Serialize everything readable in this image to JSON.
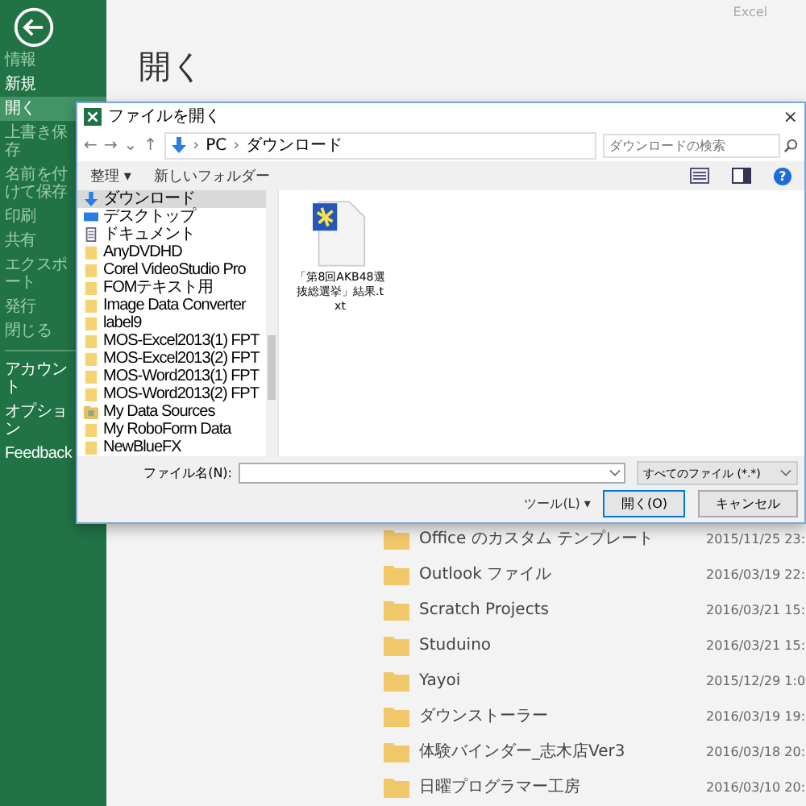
{
  "app_label": "Excel",
  "sidebar": {
    "items": [
      {
        "label": "情報",
        "selected": false,
        "disabled": true
      },
      {
        "label": "新規",
        "selected": false,
        "disabled": false
      },
      {
        "label": "開く",
        "selected": true,
        "disabled": false
      },
      {
        "label": "上書き保存",
        "selected": false,
        "disabled": true
      },
      {
        "label": "名前を付けて保存",
        "selected": false,
        "disabled": true
      },
      {
        "label": "印刷",
        "selected": false,
        "disabled": true
      },
      {
        "label": "共有",
        "selected": false,
        "disabled": true
      },
      {
        "label": "エクスポート",
        "selected": false,
        "disabled": true
      },
      {
        "label": "発行",
        "selected": false,
        "disabled": true
      },
      {
        "label": "閉じる",
        "selected": false,
        "disabled": true
      }
    ],
    "footer_items": [
      {
        "label": "アカウント",
        "selected": false,
        "disabled": false
      },
      {
        "label": "オプション",
        "selected": false,
        "disabled": false
      },
      {
        "label": "Feedback",
        "selected": false,
        "disabled": false
      }
    ]
  },
  "page_title": "開く",
  "recent_folders": [
    {
      "name": "Office のカスタム テンプレート",
      "date": "2015/11/25 23:"
    },
    {
      "name": "Outlook ファイル",
      "date": "2016/03/19 22:"
    },
    {
      "name": "Scratch Projects",
      "date": "2016/03/21 15:"
    },
    {
      "name": "Studuino",
      "date": "2016/03/21 15:"
    },
    {
      "name": "Yayoi",
      "date": "2015/12/29 1:0"
    },
    {
      "name": "ダウンストーラー",
      "date": "2016/03/19 19:"
    },
    {
      "name": "体験バインダー_志木店Ver3",
      "date": "2016/03/18 20:"
    },
    {
      "name": "日曜プログラマー工房",
      "date": "2016/03/10 20:"
    }
  ],
  "dialog": {
    "title": "ファイルを開く",
    "close": "×",
    "nav_arrows": [
      "←",
      "→",
      "⌄",
      "↑"
    ],
    "breadcrumb_separator": "›",
    "breadcrumb": [
      "PC",
      "ダウンロード"
    ],
    "search": {
      "placeholder": "ダウンロードの検索"
    },
    "toolbar": {
      "organize": "整理 ▾",
      "new_folder": "新しいフォルダー",
      "help": "?"
    },
    "nav_pane": [
      {
        "label": "ダウンロード",
        "kind": "download",
        "selected": true
      },
      {
        "label": "デスクトップ",
        "kind": "desktop",
        "selected": false
      },
      {
        "label": "ドキュメント",
        "kind": "document",
        "selected": false
      },
      {
        "label": "AnyDVDHD",
        "kind": "folder",
        "selected": false
      },
      {
        "label": "Corel VideoStudio Pro",
        "kind": "folder",
        "selected": false
      },
      {
        "label": "FOMテキスト用",
        "kind": "folder",
        "selected": false
      },
      {
        "label": "Image Data Converter",
        "kind": "folder",
        "selected": false
      },
      {
        "label": "label9",
        "kind": "folder",
        "selected": false
      },
      {
        "label": "MOS-Excel2013(1) FPT",
        "kind": "folder",
        "selected": false
      },
      {
        "label": "MOS-Excel2013(2) FPT",
        "kind": "folder",
        "selected": false
      },
      {
        "label": "MOS-Word2013(1) FPT",
        "kind": "folder",
        "selected": false
      },
      {
        "label": "MOS-Word2013(2) FPT",
        "kind": "folder",
        "selected": false
      },
      {
        "label": "My Data Sources",
        "kind": "datasource",
        "selected": false
      },
      {
        "label": "My RoboForm Data",
        "kind": "folder",
        "selected": false
      },
      {
        "label": "NewBlueFX",
        "kind": "folder",
        "selected": false
      }
    ],
    "files": [
      {
        "name": "「第8回AKB48選抜総選挙」結果.txt"
      }
    ],
    "file_name": {
      "label": "ファイル名(N):"
    },
    "file_type": "すべてのファイル (*.*)",
    "tools": "ツール(L)  ▾",
    "open_button": "開く(O)",
    "cancel_button": "キャンセル"
  }
}
